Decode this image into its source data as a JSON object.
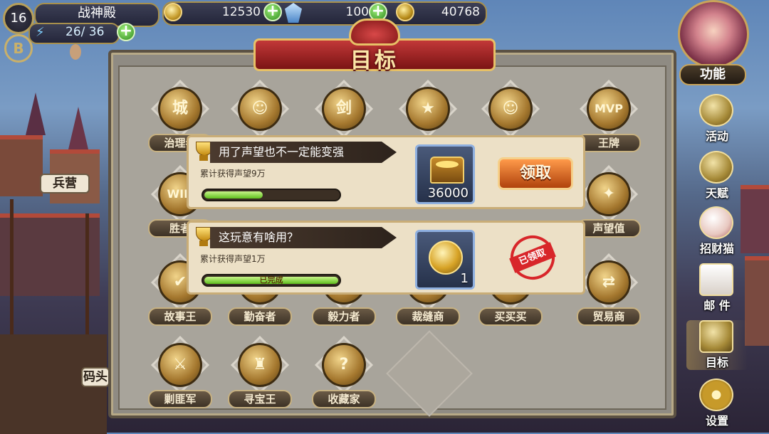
{
  "hud": {
    "level": "16",
    "guild_name": "战神殿",
    "stamina": "26/ 36",
    "coins": "12530",
    "gems": "100",
    "reputation": "40768"
  },
  "left_tags": {
    "barracks": "兵营",
    "dock": "码头"
  },
  "panel": {
    "title": "目标"
  },
  "achievements": [
    {
      "label": "治理者",
      "glyph": "城"
    },
    {
      "label": "",
      "glyph": "☺"
    },
    {
      "label": "",
      "glyph": "剑"
    },
    {
      "label": "",
      "glyph": "★"
    },
    {
      "label": "",
      "glyph": "☺"
    },
    {
      "label": "王牌",
      "glyph": "MVP"
    },
    {
      "label": "胜者",
      "glyph": "WIN"
    },
    {
      "label": "声望值",
      "glyph": "✦"
    },
    {
      "label": "故事王",
      "glyph": "✔"
    },
    {
      "label": "勤奋者",
      "glyph": "☺"
    },
    {
      "label": "毅力者",
      "glyph": "✊"
    },
    {
      "label": "裁缝商",
      "glyph": "✂"
    },
    {
      "label": "买买买",
      "glyph": "$"
    },
    {
      "label": "贸易商",
      "glyph": "⇄"
    },
    {
      "label": "剿匪军",
      "glyph": "⚔"
    },
    {
      "label": "寻宝王",
      "glyph": "♜"
    },
    {
      "label": "收藏家",
      "glyph": "?"
    }
  ],
  "tasks": [
    {
      "title": "用了声望也不一定能变强",
      "desc": "累计获得声望9万",
      "progress": 0.45,
      "progress_text": "",
      "reward_icon": "treasure-chest-icon",
      "reward_count": "36000",
      "action_label": "领取"
    },
    {
      "title": "这玩意有啥用？",
      "desc": "累计获得声望1万",
      "progress": 1.0,
      "progress_text": "已完成",
      "reward_icon": "gold-medal-icon",
      "reward_count": "1",
      "stamp_label": "已领取"
    }
  ],
  "sidebar": {
    "header": "功能",
    "items": [
      {
        "label": "活动"
      },
      {
        "label": "天赋"
      },
      {
        "label": "招财猫"
      },
      {
        "label": "邮 件"
      },
      {
        "label": "目标"
      },
      {
        "label": "设置"
      }
    ]
  }
}
